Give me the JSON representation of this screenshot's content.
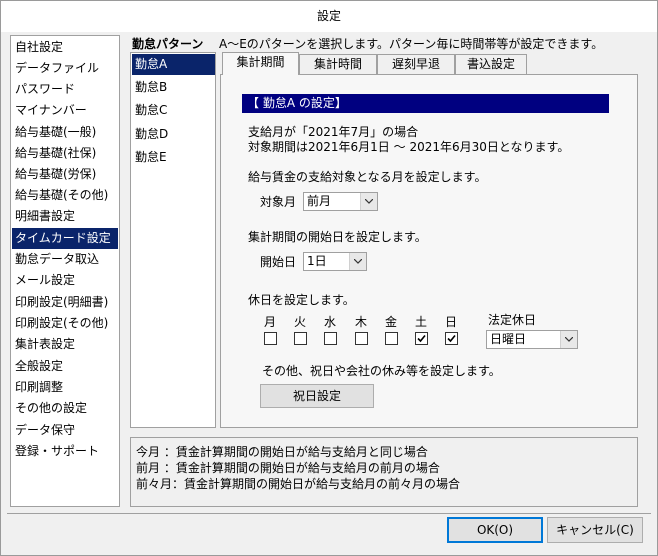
{
  "window": {
    "title": "設定"
  },
  "sidebar": {
    "items": [
      {
        "label": "自社設定",
        "selected": false
      },
      {
        "label": "データファイル",
        "selected": false
      },
      {
        "label": "パスワード",
        "selected": false
      },
      {
        "label": "マイナンバー",
        "selected": false
      },
      {
        "label": "給与基礎(一般)",
        "selected": false
      },
      {
        "label": "給与基礎(社保)",
        "selected": false
      },
      {
        "label": "給与基礎(労保)",
        "selected": false
      },
      {
        "label": "給与基礎(その他)",
        "selected": false
      },
      {
        "label": "明細書設定",
        "selected": false
      },
      {
        "label": "タイムカード設定",
        "selected": true
      },
      {
        "label": "勤怠データ取込",
        "selected": false
      },
      {
        "label": "メール設定",
        "selected": false
      },
      {
        "label": "印刷設定(明細書)",
        "selected": false
      },
      {
        "label": "印刷設定(その他)",
        "selected": false
      },
      {
        "label": "集計表設定",
        "selected": false
      },
      {
        "label": "全般設定",
        "selected": false
      },
      {
        "label": "印刷調整",
        "selected": false
      },
      {
        "label": "その他の設定",
        "selected": false
      },
      {
        "label": "データ保守",
        "selected": false
      },
      {
        "label": "登録・サポート",
        "selected": false
      }
    ]
  },
  "header": {
    "title": "勤怠パターン",
    "description": "A～Eのパターンを選択します。パターン毎に時間帯等が設定できます。"
  },
  "patterns": [
    {
      "label": "勤怠A",
      "selected": true
    },
    {
      "label": "勤怠B",
      "selected": false
    },
    {
      "label": "勤怠C",
      "selected": false
    },
    {
      "label": "勤怠D",
      "selected": false
    },
    {
      "label": "勤怠E",
      "selected": false
    }
  ],
  "tabs": [
    {
      "label": "集計期間",
      "active": true
    },
    {
      "label": "集計時間",
      "active": false
    },
    {
      "label": "遅刻早退",
      "active": false
    },
    {
      "label": "書込設定",
      "active": false
    }
  ],
  "panel": {
    "banner": "【 勤怠A の設定】",
    "payday_month": "支給月が「2021年7月」の場合",
    "target_period": "対象期間は2021年6月1日 ～ 2021年6月30日となります。",
    "target_month_heading": "給与賃金の支給対象となる月を設定します。",
    "target_month_label": "対象月",
    "target_month_value": "前月",
    "start_day_heading": "集計期間の開始日を設定します。",
    "start_day_label": "開始日",
    "start_day_value": "1日",
    "holiday_heading": "休日を設定します。",
    "weekdays": [
      {
        "label": "月",
        "checked": false
      },
      {
        "label": "火",
        "checked": false
      },
      {
        "label": "水",
        "checked": false
      },
      {
        "label": "木",
        "checked": false
      },
      {
        "label": "金",
        "checked": false
      },
      {
        "label": "土",
        "checked": true
      },
      {
        "label": "日",
        "checked": true
      }
    ],
    "legal_holiday_label": "法定休日",
    "legal_holiday_value": "日曜日",
    "other_holidays_text": "その他、祝日や会社の休み等を設定します。",
    "holiday_button": "祝日設定"
  },
  "info": {
    "lines": [
      "今月 ：賃金計算期間の開始日が給与支給月と同じ場合",
      "前月 ：賃金計算期間の開始日が給与支給月の前月の場合",
      "前々月：賃金計算期間の開始日が給与支給月の前々月の場合"
    ]
  },
  "footer": {
    "ok_label": "OK(O)",
    "cancel_label": "キャンセル(C)"
  },
  "colors": {
    "selection": "#0a246a",
    "banner": "#000080",
    "default_button_border": "#0078d7"
  }
}
